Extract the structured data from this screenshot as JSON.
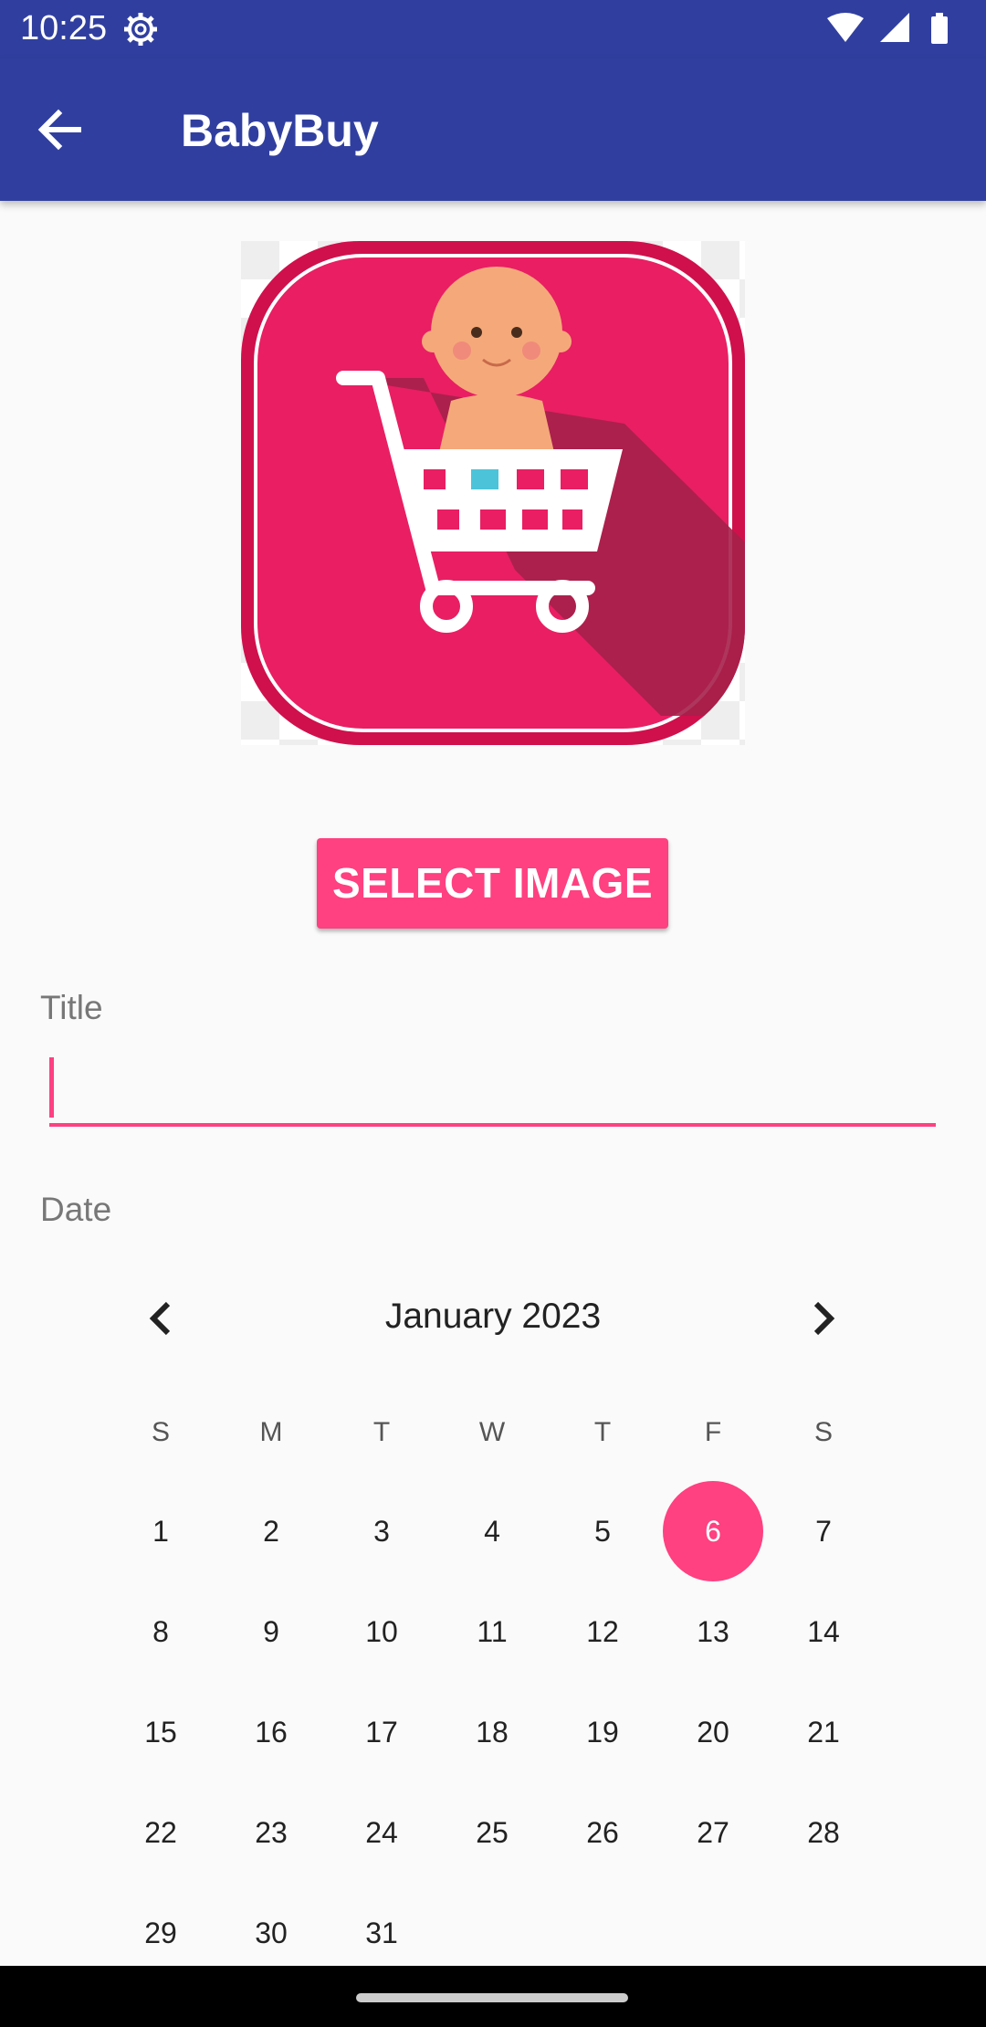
{
  "status_bar": {
    "time": "10:25"
  },
  "app_bar": {
    "title": "BabyBuy"
  },
  "select_image_button": "SELECT IMAGE",
  "title_field": {
    "label": "Title",
    "value": ""
  },
  "date_field": {
    "label": "Date"
  },
  "calendar": {
    "month_label": "January 2023",
    "weekdays": [
      "S",
      "M",
      "T",
      "W",
      "T",
      "F",
      "S"
    ],
    "selected_day": "6",
    "weeks": [
      [
        "1",
        "2",
        "3",
        "4",
        "5",
        "6",
        "7"
      ],
      [
        "8",
        "9",
        "10",
        "11",
        "12",
        "13",
        "14"
      ],
      [
        "15",
        "16",
        "17",
        "18",
        "19",
        "20",
        "21"
      ],
      [
        "22",
        "23",
        "24",
        "25",
        "26",
        "27",
        "28"
      ],
      [
        "29",
        "30",
        "31",
        "",
        "",
        "",
        ""
      ]
    ]
  },
  "colors": {
    "primary": "#303f9f",
    "accent": "#ff4081"
  }
}
